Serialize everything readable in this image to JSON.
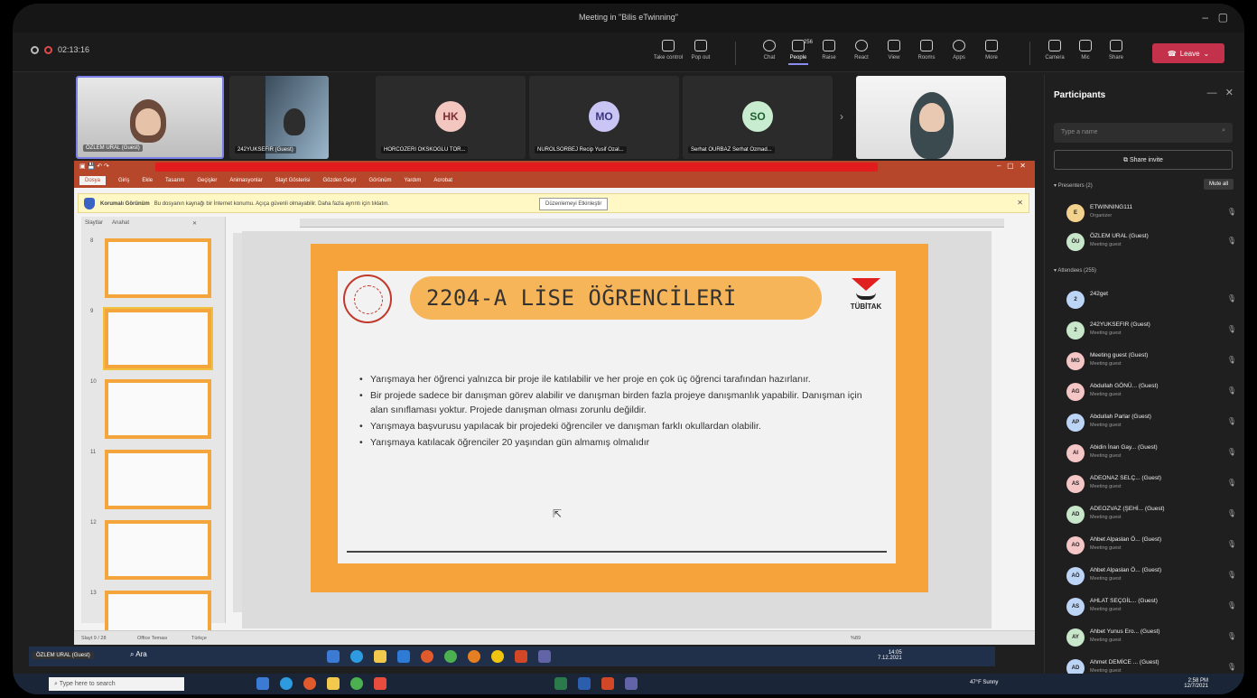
{
  "window": {
    "title": "Meeting in \"Bilis eTwinning\""
  },
  "meeting": {
    "timer": "02:13:16",
    "toolbar": [
      {
        "label": "Take control",
        "icon": "take-control-icon"
      },
      {
        "label": "Pop out",
        "icon": "pop-out-icon"
      },
      {
        "label": "Chat",
        "icon": "chat-icon"
      },
      {
        "label": "People",
        "icon": "people-icon",
        "badge": "256"
      },
      {
        "label": "Raise",
        "icon": "raise-hand-icon"
      },
      {
        "label": "React",
        "icon": "react-icon"
      },
      {
        "label": "View",
        "icon": "view-icon"
      },
      {
        "label": "Rooms",
        "icon": "rooms-icon"
      },
      {
        "label": "Apps",
        "icon": "apps-icon"
      },
      {
        "label": "More",
        "icon": "more-icon"
      },
      {
        "label": "Camera",
        "icon": "camera-icon"
      },
      {
        "label": "Mic",
        "icon": "mic-icon"
      },
      {
        "label": "Share",
        "icon": "share-icon"
      }
    ],
    "leave_label": "Leave"
  },
  "videos": [
    {
      "name": "ÖZLEM URAL (Guest)",
      "type": "camera"
    },
    {
      "name": "242YUKSEFIR (Guest)",
      "type": "camera"
    },
    {
      "name": "HORCOZERI OKSKOGLU TOR...",
      "type": "avatar",
      "initials": "HK",
      "color": "#f3c7c0"
    },
    {
      "name": "NUROLSORBEJ Recip Yusif Ozal...",
      "type": "avatar",
      "initials": "MO",
      "color": "#c9c6f5"
    },
    {
      "name": "Serhat OURBAZ Serhat Ozmad...",
      "type": "avatar",
      "initials": "SO",
      "color": "#c7ecd0"
    },
    {
      "name": "",
      "type": "camera"
    }
  ],
  "participants_panel": {
    "title": "Participants",
    "search_placeholder": "Type a name",
    "share_invite": "Share invite",
    "presenters_label": "Presenters (2)",
    "mute_all": "Mute all",
    "attendees_label": "Attendees (255)",
    "presenters": [
      {
        "initials": "E",
        "name": "ETWINNING111",
        "role": "Organizer",
        "color": "#f2d28c"
      },
      {
        "initials": "ÖU",
        "name": "ÖZLEM URAL (Guest)",
        "role": "Meeting guest",
        "color": "#c8e6c9"
      }
    ],
    "attendees": [
      {
        "initials": "2",
        "name": "242get",
        "role": "",
        "color": "#bcd4f5"
      },
      {
        "initials": "2",
        "name": "242YUKSEFIR (Guest)",
        "role": "Meeting guest",
        "color": "#c8e6c9"
      },
      {
        "initials": "MG",
        "name": "Meeting guest (Guest)",
        "role": "Meeting guest",
        "color": "#f5c6c6"
      },
      {
        "initials": "AG",
        "name": "Abdullah GÖNÜ... (Guest)",
        "role": "Meeting guest",
        "color": "#f5c6c6"
      },
      {
        "initials": "AP",
        "name": "Abdullah Parlar (Guest)",
        "role": "Meeting guest",
        "color": "#bcd4f5"
      },
      {
        "initials": "AI",
        "name": "Abidin İnan Gay... (Guest)",
        "role": "Meeting guest",
        "color": "#f5c6c6"
      },
      {
        "initials": "AS",
        "name": "ADEONAZ SELÇ... (Guest)",
        "role": "Meeting guest",
        "color": "#f5c6c6"
      },
      {
        "initials": "AD",
        "name": "ADEOZVAZ (ŞEHİ... (Guest)",
        "role": "Meeting guest",
        "color": "#c8e6c9"
      },
      {
        "initials": "AO",
        "name": "Ahbet Alpaslan Ö... (Guest)",
        "role": "Meeting guest",
        "color": "#f5c6c6"
      },
      {
        "initials": "AÖ",
        "name": "Ahbet Alpaslan Ö... (Guest)",
        "role": "Meeting guest",
        "color": "#bcd4f5"
      },
      {
        "initials": "AS",
        "name": "AHLAT SEÇGİL... (Guest)",
        "role": "Meeting guest",
        "color": "#bcd4f5"
      },
      {
        "initials": "AY",
        "name": "Ahbet Yunus Ero... (Guest)",
        "role": "Meeting guest",
        "color": "#c8e6c9"
      },
      {
        "initials": "AD",
        "name": "Ahmet DEMİCE ... (Guest)",
        "role": "Meeting guest",
        "color": "#bcd4f5"
      }
    ]
  },
  "powerpoint": {
    "tabs": [
      "Dosya",
      "Giriş",
      "Ekle",
      "Tasarım",
      "Geçişler",
      "Animasyonlar",
      "Slayt Gösterisi",
      "Gözden Geçir",
      "Görünüm",
      "Yardım",
      "Acrobat"
    ],
    "selected_tab": "Dosya",
    "protected_view": {
      "title": "Korumalı Görünüm",
      "message": "Bu dosyanın kaynağı bir İnternet konumu. Açıça güvenli olmayabilir. Daha fazla ayrıntı için tıklatın.",
      "enable_button": "Düzenlemeyi Etkinleştir"
    },
    "pane_tabs": [
      "Slaytlar",
      "Anahat"
    ],
    "thumbnail_numbers": [
      "8",
      "9",
      "10",
      "11",
      "12",
      "13"
    ],
    "status": {
      "slide": "Slayt 9 / 28",
      "theme": "Office Teması",
      "lang": "Türkçe",
      "zoom": "%89"
    }
  },
  "slide": {
    "title": "2204-A LİSE ÖĞRENCİLERİ",
    "logo_text": "TÜBİTAK",
    "bullets": [
      "Yarışmaya her öğrenci yalnızca bir proje ile katılabilir ve her proje en çok üç öğrenci tarafından hazırlanır.",
      " Bir projede sadece bir danışman görev alabilir ve danışman birden fazla projeye danışmanlık yapabilir. Danışman için alan sınıflaması yoktur. Projede danışman olması zorunlu değildir.",
      "Yarışmaya başvurusu yapılacak bir projedeki öğrenciler ve danışman farklı okullardan olabilir.",
      "Yarışmaya katılacak öğrenciler 20 yaşından gün almamış olmalıdır"
    ]
  },
  "inner_taskbar": {
    "presenter_label": "ÖZLEM URAL (Guest)",
    "search": "Ara",
    "time": "14:05",
    "date": "7.12.2021"
  },
  "host_taskbar": {
    "search_placeholder": "Type here to search",
    "weather": "47°F Sunny",
    "time": "2:58 PM",
    "date": "12/7/2021"
  }
}
